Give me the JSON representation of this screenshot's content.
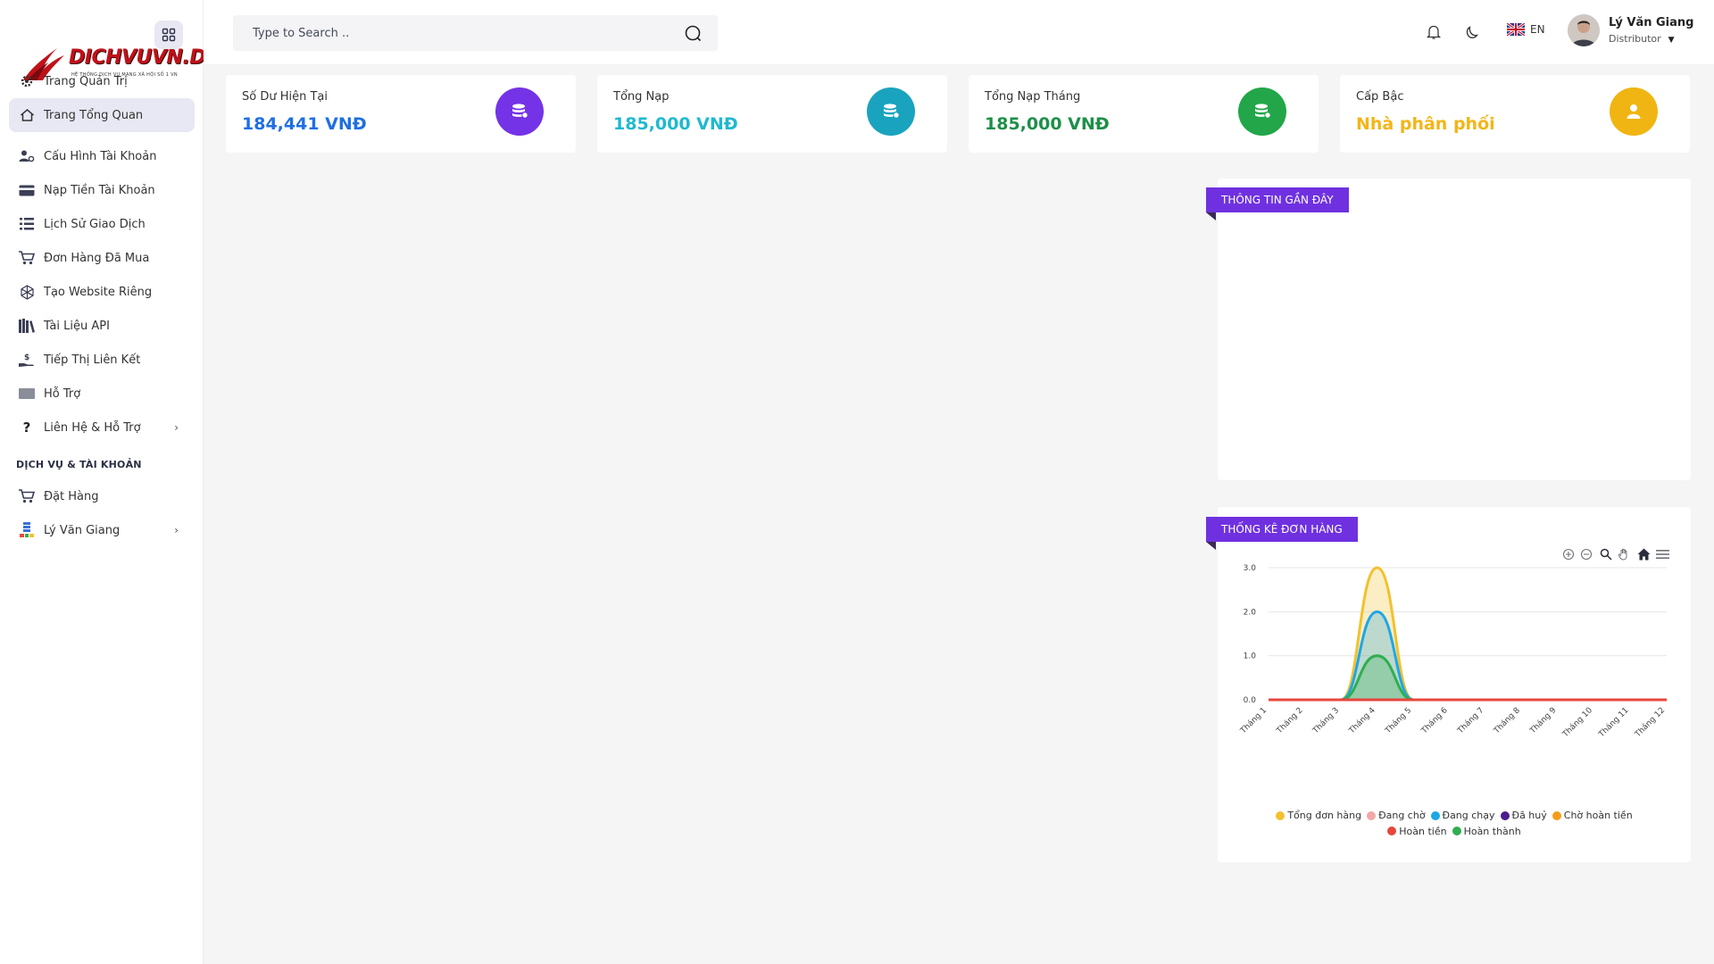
{
  "sidebar": {
    "logo": {
      "text": "DICHVUVN.DEV",
      "tagline": "HỆ THỐNG DỊCH VỤ MẠNG XÃ HỘI SỐ 1 VN"
    },
    "items": [
      {
        "label": "Trang Quản Trị",
        "icon": "gear-icon"
      },
      {
        "label": "Trang Tổng Quan",
        "icon": "home-icon",
        "active": true
      },
      {
        "label": "Cấu Hình Tài Khoản",
        "icon": "users-cog-icon"
      },
      {
        "label": "Nạp Tiền Tài Khoản",
        "icon": "credit-card-icon"
      },
      {
        "label": "Lịch Sử Giao Dịch",
        "icon": "list-icon"
      },
      {
        "label": "Đơn Hàng Đã Mua",
        "icon": "cart-icon"
      },
      {
        "label": "Tạo Website Riêng",
        "icon": "globe-icon"
      },
      {
        "label": "Tài Liệu API",
        "icon": "books-icon"
      },
      {
        "label": "Tiếp Thị Liên Kết",
        "icon": "hand-money-icon"
      },
      {
        "label": "Hỗ Trợ",
        "icon": "ticket-icon"
      },
      {
        "label": "Liên Hệ & Hỗ Trợ",
        "icon": "question-icon",
        "has_children": true
      }
    ],
    "section_title": "DỊCH VỤ & TÀI KHOẢN",
    "section_items": [
      {
        "label": "Đặt Hàng",
        "icon": "cart-icon"
      },
      {
        "label": "Lý Văn Giang",
        "icon": "server-icon",
        "has_children": true
      }
    ]
  },
  "topbar": {
    "search_placeholder": "Type to Search ..",
    "lang": "EN",
    "user_name": "Lý Văn Giang",
    "user_role": "Distributor"
  },
  "cards": [
    {
      "label": "Số Dư Hiện Tại",
      "value": "184,441 VNĐ",
      "color": "#1f6fe3",
      "icon_bg": "#7433e6"
    },
    {
      "label": "Tổng Nạp",
      "value": "185,000 VNĐ",
      "color": "#1fb8d0",
      "icon_bg": "#1aa3be"
    },
    {
      "label": "Tổng Nạp Tháng",
      "value": "185,000 VNĐ",
      "color": "#1e8f48",
      "icon_bg": "#22a649"
    },
    {
      "label": "Cấp Bậc",
      "value": "Nhà phân phối",
      "color": "#f3b518",
      "icon_bg": "#f0b512"
    }
  ],
  "panels": {
    "recent_title": "THÔNG TIN GẦN ĐÂY",
    "orders_title": "THỐNG KÊ ĐƠN HÀNG"
  },
  "chart_data": {
    "type": "area",
    "categories": [
      "Tháng 1",
      "Tháng 2",
      "Tháng 3",
      "Tháng 4",
      "Tháng 5",
      "Tháng 6",
      "Tháng 7",
      "Tháng 8",
      "Tháng 9",
      "Tháng 10",
      "Tháng 11",
      "Tháng 12"
    ],
    "ylim": [
      0,
      3
    ],
    "yticks": [
      "0.0",
      "1.0",
      "2.0",
      "3.0"
    ],
    "grid": true,
    "legend_position": "bottom",
    "series": [
      {
        "name": "Tổng đơn hàng",
        "color": "#f2c12e",
        "values": [
          0,
          0,
          0,
          3,
          0,
          0,
          0,
          0,
          0,
          0,
          0,
          0
        ]
      },
      {
        "name": "Đang chờ",
        "color": "#f4a6a6",
        "values": [
          0,
          0,
          0,
          0,
          0,
          0,
          0,
          0,
          0,
          0,
          0,
          0
        ]
      },
      {
        "name": "Đang chạy",
        "color": "#1ea7e6",
        "values": [
          0,
          0,
          0,
          2,
          0,
          0,
          0,
          0,
          0,
          0,
          0,
          0
        ]
      },
      {
        "name": "Đã huỷ",
        "color": "#4b1c8c",
        "values": [
          0,
          0,
          0,
          0,
          0,
          0,
          0,
          0,
          0,
          0,
          0,
          0
        ]
      },
      {
        "name": "Chờ hoàn tiền",
        "color": "#f59c1a",
        "values": [
          0,
          0,
          0,
          0,
          0,
          0,
          0,
          0,
          0,
          0,
          0,
          0
        ]
      },
      {
        "name": "Hoàn tiền",
        "color": "#e8463d",
        "values": [
          0,
          0,
          0,
          0,
          0,
          0,
          0,
          0,
          0,
          0,
          0,
          0
        ]
      },
      {
        "name": "Hoàn thành",
        "color": "#2fae4f",
        "values": [
          0,
          0,
          0,
          1,
          0,
          0,
          0,
          0,
          0,
          0,
          0,
          0
        ]
      }
    ]
  }
}
